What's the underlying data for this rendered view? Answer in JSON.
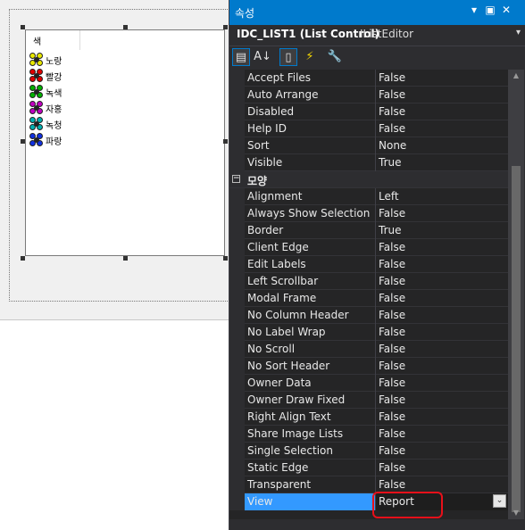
{
  "designer": {
    "list_header": "색",
    "list_items": [
      {
        "label": "노랑",
        "color": "#e8e800"
      },
      {
        "label": "빨강",
        "color": "#e00000"
      },
      {
        "label": "녹색",
        "color": "#00b000"
      },
      {
        "label": "자홍",
        "color": "#c000c0"
      },
      {
        "label": "녹청",
        "color": "#00b0b0"
      },
      {
        "label": "파랑",
        "color": "#1030e0"
      }
    ]
  },
  "properties": {
    "title": "속성",
    "title_controls": {
      "dropdown": "▾",
      "pin": "▣",
      "close": "✕"
    },
    "object_name": "IDC_LIST1 (List Control)",
    "object_type": "IListEditor",
    "object_dropdown": "▾",
    "toolbar": [
      {
        "name": "categorized-icon",
        "glyph": "▤"
      },
      {
        "name": "alphabetical-icon",
        "glyph": "A↓"
      },
      {
        "name": "properties-page-icon",
        "glyph": "▯"
      },
      {
        "name": "events-icon",
        "glyph": "⚡"
      },
      {
        "name": "property-pages-icon",
        "glyph": "🔧"
      }
    ],
    "rows": [
      {
        "name": "Accept Files",
        "value": "False"
      },
      {
        "name": "Auto Arrange",
        "value": "False"
      },
      {
        "name": "Disabled",
        "value": "False"
      },
      {
        "name": "Help ID",
        "value": "False"
      },
      {
        "name": "Sort",
        "value": "None"
      },
      {
        "name": "Visible",
        "value": "True"
      },
      {
        "category": "모양",
        "toggle": "−"
      },
      {
        "name": "Alignment",
        "value": "Left"
      },
      {
        "name": "Always Show Selection",
        "value": "False"
      },
      {
        "name": "Border",
        "value": "True"
      },
      {
        "name": "Client Edge",
        "value": "False"
      },
      {
        "name": "Edit Labels",
        "value": "False"
      },
      {
        "name": "Left Scrollbar",
        "value": "False"
      },
      {
        "name": "Modal Frame",
        "value": "False"
      },
      {
        "name": "No Column Header",
        "value": "False"
      },
      {
        "name": "No Label Wrap",
        "value": "False"
      },
      {
        "name": "No Scroll",
        "value": "False"
      },
      {
        "name": "No Sort Header",
        "value": "False"
      },
      {
        "name": "Owner Data",
        "value": "False"
      },
      {
        "name": "Owner Draw Fixed",
        "value": "False"
      },
      {
        "name": "Right Align Text",
        "value": "False"
      },
      {
        "name": "Share Image Lists",
        "value": "False"
      },
      {
        "name": "Single Selection",
        "value": "False"
      },
      {
        "name": "Static Edge",
        "value": "False"
      },
      {
        "name": "Transparent",
        "value": "False"
      },
      {
        "name": "View",
        "value": "Report",
        "selected": true
      }
    ],
    "scroll": {
      "up": "▲",
      "down": "▼"
    }
  },
  "colors": {
    "accent": "#007acc",
    "selection": "#3399ff",
    "annotation": "#e8101a"
  }
}
